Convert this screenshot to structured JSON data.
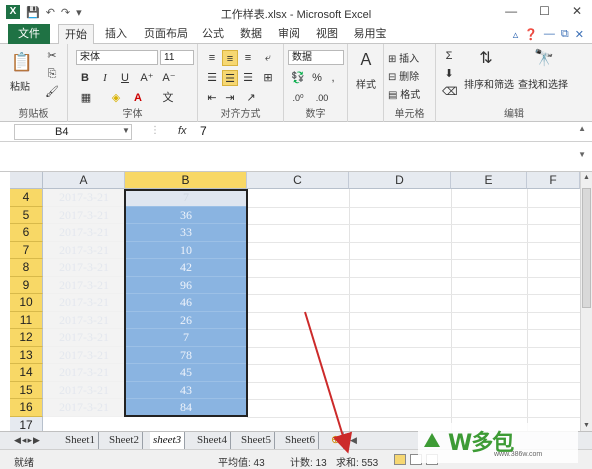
{
  "window": {
    "title": "工作样表.xlsx - Microsoft Excel",
    "controls": [
      "—",
      "☐",
      "✕"
    ]
  },
  "tabs": {
    "file": "文件",
    "items": [
      "开始",
      "插入",
      "页面布局",
      "公式",
      "数据",
      "审阅",
      "视图",
      "易用宝"
    ],
    "active": "开始"
  },
  "ribbon": {
    "clipboard": {
      "label": "剪贴板",
      "paste": "粘贴"
    },
    "font": {
      "label": "字体",
      "font_name": "宋体",
      "font_size": "11",
      "bold": "B",
      "italic": "I",
      "underline": "U"
    },
    "alignment": {
      "label": "对齐方式"
    },
    "number": {
      "label": "数字",
      "format": "数据"
    },
    "styles": {
      "label": "",
      "button": "样式"
    },
    "cells": {
      "label": "单元格",
      "insert": "插入",
      "delete": "删除",
      "format": "格式"
    },
    "editing": {
      "label": "编辑",
      "sort_filter": "排序和筛选",
      "find_select": "查找和选择"
    }
  },
  "formula_bar": {
    "name_box": "B4",
    "fx": "fx",
    "value": "7"
  },
  "columns": [
    "A",
    "B",
    "C",
    "D",
    "E",
    "F"
  ],
  "rows": [
    {
      "num": "4",
      "a": "2017-3-21",
      "b": "7"
    },
    {
      "num": "5",
      "a": "2017-3-21",
      "b": "36"
    },
    {
      "num": "6",
      "a": "2017-3-21",
      "b": "33"
    },
    {
      "num": "7",
      "a": "2017-3-21",
      "b": "10"
    },
    {
      "num": "8",
      "a": "2017-3-21",
      "b": "42"
    },
    {
      "num": "9",
      "a": "2017-3-21",
      "b": "96"
    },
    {
      "num": "10",
      "a": "2017-3-21",
      "b": "46"
    },
    {
      "num": "11",
      "a": "2017-3-21",
      "b": "26"
    },
    {
      "num": "12",
      "a": "2017-3-21",
      "b": "7"
    },
    {
      "num": "13",
      "a": "2017-3-21",
      "b": "78"
    },
    {
      "num": "14",
      "a": "2017-3-21",
      "b": "45"
    },
    {
      "num": "15",
      "a": "2017-3-21",
      "b": "43"
    },
    {
      "num": "16",
      "a": "2017-3-21",
      "b": "84"
    }
  ],
  "extra_row": "17",
  "sheets": [
    "Sheet1",
    "Sheet2",
    "sheet3",
    "Sheet4",
    "Sheet5",
    "Sheet6"
  ],
  "active_sheet": "sheet3",
  "status": {
    "ready": "就绪",
    "average": "平均值: 43",
    "count": "计数: 13",
    "sum": "求和: 553"
  },
  "watermark": {
    "logo": "W多包",
    "url": "www.386w.com"
  },
  "colors": {
    "excel_green": "#1f7244",
    "selection_blue": "#8ab4e1",
    "header_highlight": "#f8d866",
    "arrow": "#cc2a2a"
  }
}
